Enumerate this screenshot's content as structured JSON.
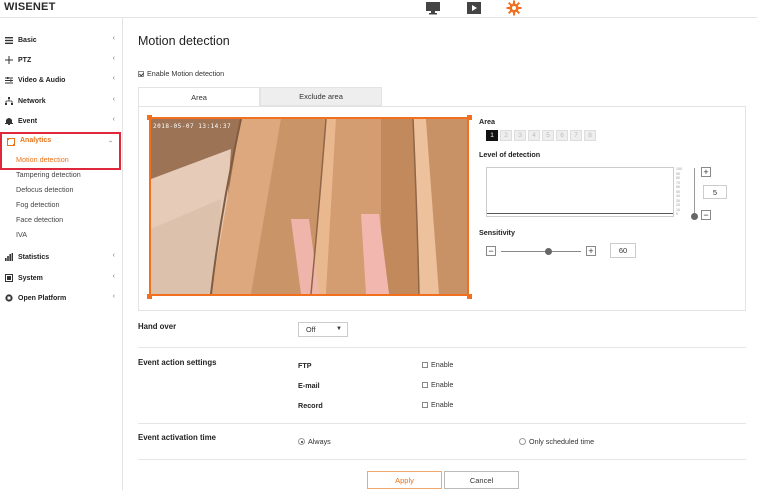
{
  "brand": {
    "logo": "WISENET",
    "accent": "#f07020",
    "selected_text": "#e8741d",
    "highlight_border": "#e0283c"
  },
  "topbar": {
    "icons": [
      "monitor-icon",
      "play-icon",
      "gear-icon"
    ]
  },
  "sidebar": {
    "items": [
      {
        "label": "Basic",
        "icon": "list-icon"
      },
      {
        "label": "PTZ",
        "icon": "move-icon"
      },
      {
        "label": "Video & Audio",
        "icon": "sliders-icon"
      },
      {
        "label": "Network",
        "icon": "network-icon"
      },
      {
        "label": "Event",
        "icon": "bell-icon"
      },
      {
        "label": "Analytics",
        "icon": "analytics-icon",
        "expanded": true
      },
      {
        "label": "Statistics",
        "icon": "bar-chart-icon"
      },
      {
        "label": "System",
        "icon": "system-icon"
      },
      {
        "label": "Open Platform",
        "icon": "platform-icon"
      }
    ],
    "analytics_sub": [
      "Motion detection",
      "Tampering detection",
      "Defocus detection",
      "Fog detection",
      "Face detection",
      "IVA"
    ]
  },
  "page": {
    "title": "Motion detection",
    "enable_label": "Enable Motion detection",
    "enable_checked": true,
    "tabs": [
      "Area",
      "Exclude area"
    ],
    "active_tab": "Area",
    "video_timestamp": "2018-05-07 13:14:37",
    "area": {
      "label": "Area",
      "numbers": [
        "1",
        "2",
        "3",
        "4",
        "5",
        "6",
        "7",
        "8"
      ],
      "selected": "1"
    },
    "level": {
      "label": "Level of detection",
      "value": "5",
      "scale": [
        "100",
        "90",
        "80",
        "70",
        "60",
        "50",
        "40",
        "30",
        "20",
        "10",
        "0"
      ]
    },
    "sensitivity": {
      "label": "Sensitivity",
      "value": "60"
    },
    "handover": {
      "label": "Hand over",
      "value": "Off"
    },
    "event_action": {
      "label": "Event action settings",
      "rows": [
        {
          "name": "FTP",
          "enable": "Enable",
          "checked": false
        },
        {
          "name": "E-mail",
          "enable": "Enable",
          "checked": false
        },
        {
          "name": "Record",
          "enable": "Enable",
          "checked": false
        }
      ]
    },
    "activation": {
      "label": "Event activation time",
      "options": [
        "Always",
        "Only scheduled time"
      ],
      "selected": "Always"
    },
    "buttons": {
      "apply": "Apply",
      "cancel": "Cancel"
    }
  }
}
